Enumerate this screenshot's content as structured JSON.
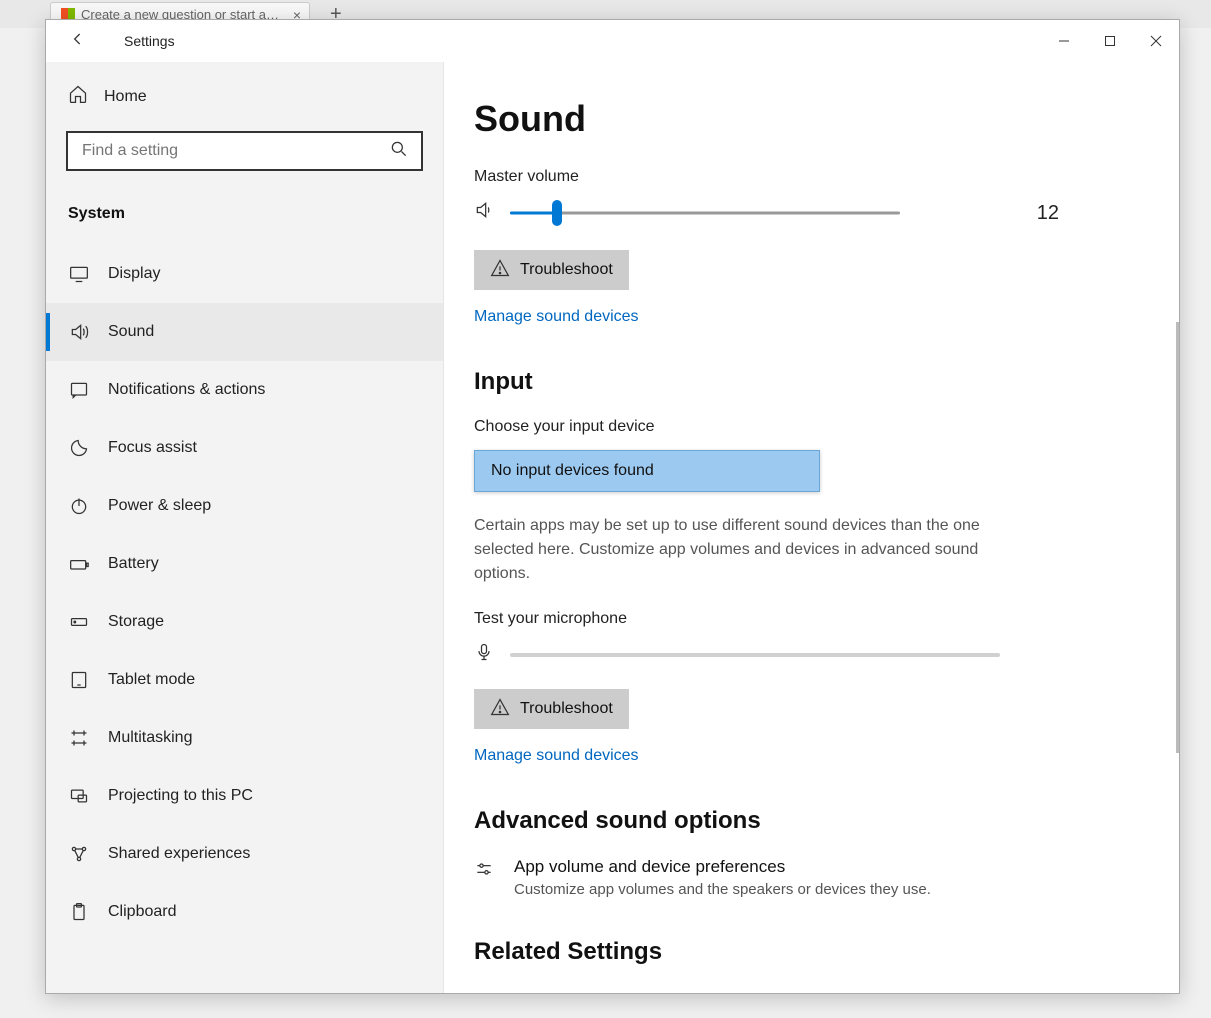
{
  "bgTab": {
    "title": "Create a new question or start a…"
  },
  "window": {
    "title": "Settings"
  },
  "sidebar": {
    "home": "Home",
    "searchPlaceholder": "Find a setting",
    "category": "System",
    "items": [
      {
        "label": "Display"
      },
      {
        "label": "Sound"
      },
      {
        "label": "Notifications & actions"
      },
      {
        "label": "Focus assist"
      },
      {
        "label": "Power & sleep"
      },
      {
        "label": "Battery"
      },
      {
        "label": "Storage"
      },
      {
        "label": "Tablet mode"
      },
      {
        "label": "Multitasking"
      },
      {
        "label": "Projecting to this PC"
      },
      {
        "label": "Shared experiences"
      },
      {
        "label": "Clipboard"
      }
    ]
  },
  "main": {
    "title": "Sound",
    "masterVolumeLabel": "Master volume",
    "volumeValue": "12",
    "volumePercent": 12,
    "troubleshootLabel": "Troubleshoot",
    "manageDevicesLabel": "Manage sound devices",
    "inputHeading": "Input",
    "chooseInputLabel": "Choose your input device",
    "inputDeviceValue": "No input devices found",
    "inputDesc": "Certain apps may be set up to use different sound devices than the one selected here. Customize app volumes and devices in advanced sound options.",
    "testMicLabel": "Test your microphone",
    "advancedHeading": "Advanced sound options",
    "appVolTitle": "App volume and device preferences",
    "appVolDesc": "Customize app volumes and the speakers or devices they use.",
    "relatedHeading": "Related Settings"
  }
}
